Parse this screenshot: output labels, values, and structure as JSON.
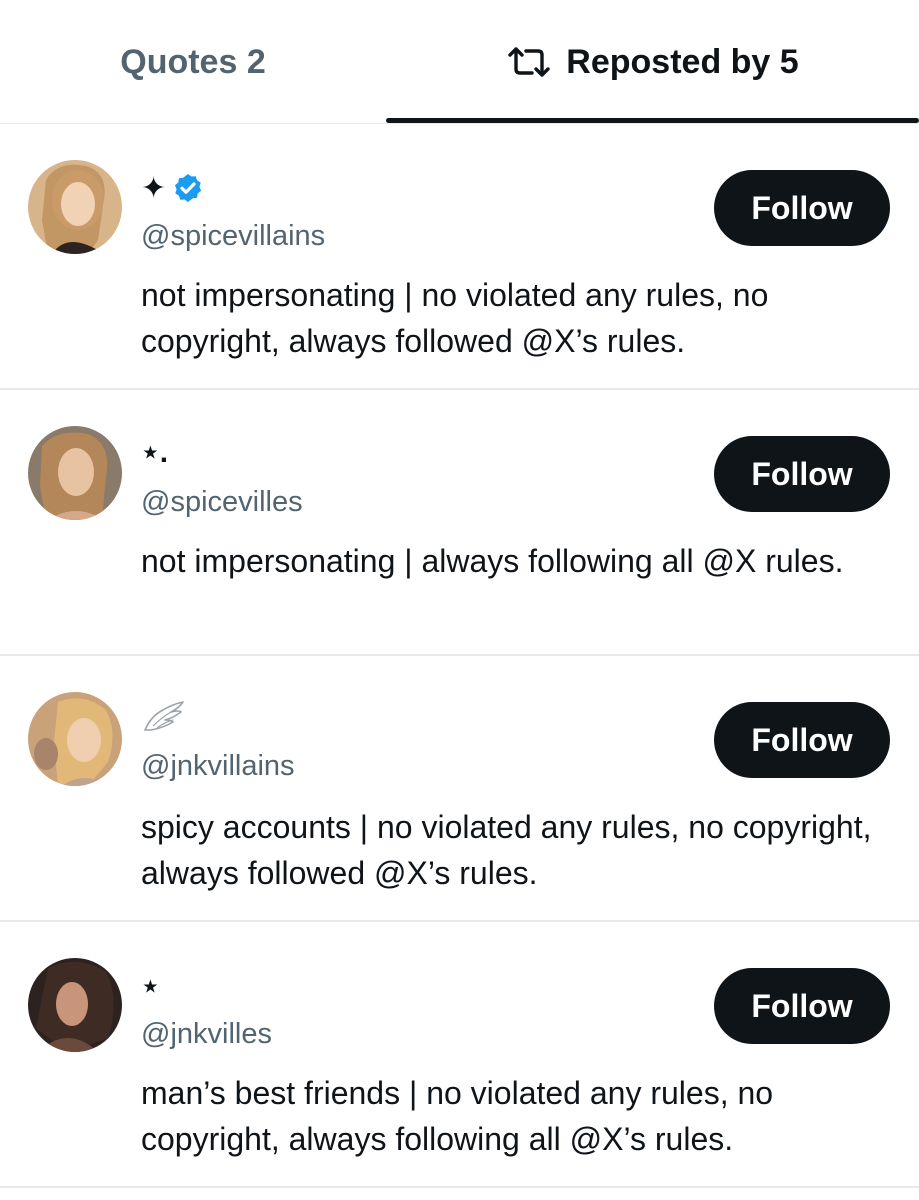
{
  "tabs": {
    "quotes_label": "Quotes 2",
    "reposted_label": "Reposted by 5",
    "reposted_icon": "repost-icon"
  },
  "users": [
    {
      "display_name": "✦",
      "verified": true,
      "handle": "@spicevillains",
      "bio": "not impersonating | no violated any rules, no copyright, always followed @X’s rules.",
      "follow_label": "Follow"
    },
    {
      "display_name": "⋆.",
      "verified": false,
      "handle": "@spicevilles",
      "bio": "not impersonating | always following all @X rules.",
      "follow_label": "Follow"
    },
    {
      "display_name": "",
      "name_icon": "wings-icon",
      "verified": false,
      "handle": "@jnkvillains",
      "bio": "spicy accounts | no violated any rules, no copyright, always followed @X’s rules.",
      "follow_label": "Follow"
    },
    {
      "display_name": "⋆",
      "verified": false,
      "handle": "@jnkvilles",
      "bio": "man’s best friends | no violated any rules, no copyright, always following all @X’s rules.",
      "follow_label": "Follow"
    }
  ],
  "colors": {
    "text_primary": "#0f1419",
    "text_secondary": "#536471",
    "divider": "#e7e9ea",
    "verified_blue": "#1d9bf0",
    "button_bg": "#0f1419"
  }
}
